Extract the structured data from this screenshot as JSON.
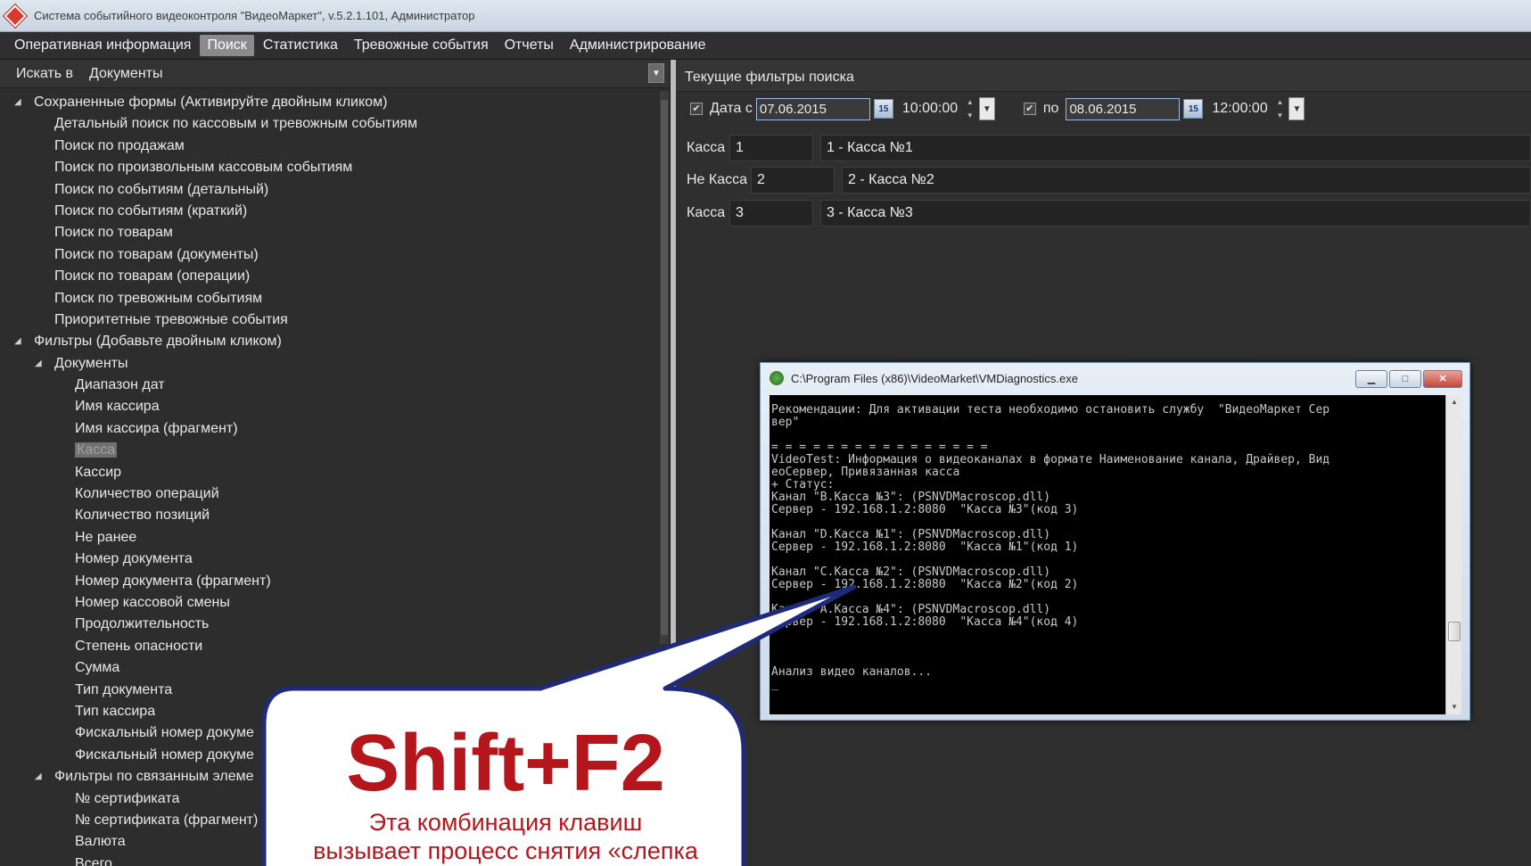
{
  "window": {
    "title": "Система событийного видеоконтроля \"ВидеоМаркет\", v.5.2.1.101, Администратор"
  },
  "menu": [
    "Оперативная информация",
    "Поиск",
    "Статистика",
    "Тревожные события",
    "Отчеты",
    "Администрирование"
  ],
  "search": {
    "label": "Искать в",
    "value": "Документы"
  },
  "tree": {
    "saved_forms_header": "Сохраненные формы (Активируйте двойным кликом)",
    "saved_forms": [
      "Детальный поиск по кассовым и тревожным событиям",
      "Поиск по продажам",
      "Поиск по произвольным кассовым событиям",
      "Поиск по событиям (детальный)",
      "Поиск по событиям (краткий)",
      "Поиск по товарам",
      "Поиск по товарам (документы)",
      "Поиск по товарам (операции)",
      "Поиск по тревожным событиям",
      "Приоритетные тревожные события"
    ],
    "filters_header": "Фильтры (Добавьте двойным кликом)",
    "documents_header": "Документы",
    "document_filters": [
      "Диапазон дат",
      "Имя кассира",
      "Имя кассира (фрагмент)",
      "Касса",
      "Кассир",
      "Количество операций",
      "Количество позиций",
      "Не ранее",
      "Номер документа",
      "Номер документа (фрагмент)",
      "Номер кассовой смены",
      "Продолжительность",
      "Степень опасности",
      "Сумма",
      "Тип документа",
      "Тип кассира",
      "Фискальный номер докуме",
      "Фискальный номер докуме"
    ],
    "related_header": "Фильтры по связанным элеме",
    "related_filters": [
      "№ сертификата",
      "№ сертификата (фрагмент)",
      "Валюта",
      "Всего"
    ]
  },
  "filters": {
    "header": "Текущие фильтры поиска",
    "date_from_label": "Дата с",
    "date_from": "07.06.2015",
    "time_from": "10:00:00",
    "date_to_label": "по",
    "date_to": "08.06.2015",
    "time_to": "12:00:00",
    "calendar_glyph": "15",
    "rows": [
      {
        "label": "Касса",
        "code": "1",
        "name": "1 - Касса №1"
      },
      {
        "label": "Не Касса",
        "code": "2",
        "name": "2 - Касса №2"
      },
      {
        "label": "Касса",
        "code": "3",
        "name": "3 - Касса №3"
      }
    ]
  },
  "console": {
    "title": "C:\\Program Files (x86)\\VideoMarket\\VMDiagnostics.exe",
    "text": "Рекомендации: Для активации теста необходимо остановить службу  \"ВидеоМаркет Сер\nвер\"\n\n= = = = = = = = = = = = = = = =\nVideoTest: Информация о видеоканалах в формате Наименование канала, Драйвер, Вид\nеоСервер, Привязанная касса\n+ Статус:\nКанал \"B.Касса №3\": (PSNVDMacroscop.dll)\nСервер - 192.168.1.2:8080  \"Касса №3\"(код 3)\n\nКанал \"D.Касса №1\": (PSNVDMacroscop.dll)\nСервер - 192.168.1.2:8080  \"Касса №1\"(код 1)\n\nКанал \"C.Касса №2\": (PSNVDMacroscop.dll)\nСервер - 192.168.1.2:8080  \"Касса №2\"(код 2)\n\nКанал \"A.Касса №4\": (PSNVDMacroscop.dll)\nСервер - 192.168.1.2:8080  \"Касса №4\"(код 4)\n\n\n\nАнализ видео каналов...\n_"
  },
  "callout": {
    "keys": "Shift+F2",
    "caption": "Эта комбинация клавиш\nвызывает процесс снятия «слепка"
  },
  "colors": {
    "callout_border": "#1f2a7a",
    "callout_text": "#b5161c"
  }
}
